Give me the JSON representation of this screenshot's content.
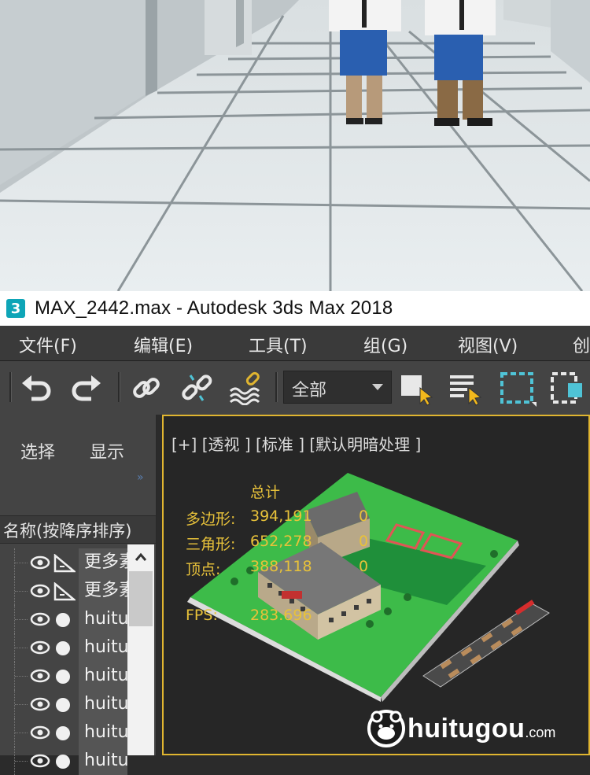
{
  "window": {
    "title": "MAX_2442.max - Autodesk 3ds Max 2018",
    "app_icon_glyph": "3"
  },
  "menu": [
    {
      "label": "文件(F)"
    },
    {
      "label": "编辑(E)"
    },
    {
      "label": "工具(T)"
    },
    {
      "label": "组(G)"
    },
    {
      "label": "视图(V)"
    },
    {
      "label": "创"
    }
  ],
  "toolbar": {
    "icons": [
      "undo-icon",
      "redo-icon",
      "link-icon",
      "unlink-icon",
      "bind-space-warp-icon",
      "select-object-icon",
      "select-by-name-icon",
      "rectangular-selection-region-icon",
      "window-crossing-icon"
    ],
    "selection_set_value": "全部",
    "accent_color": "#4fc3d6"
  },
  "left_panel": {
    "tabs": [
      "选择",
      "显示"
    ],
    "expand_glyph": "»",
    "column_header": "名称(按降序排序)",
    "rows": [
      {
        "name": "更多素",
        "kind": "helper"
      },
      {
        "name": "更多素",
        "kind": "helper"
      },
      {
        "name": "huitu",
        "kind": "geometry"
      },
      {
        "name": "huitu",
        "kind": "geometry"
      },
      {
        "name": "huitu",
        "kind": "geometry"
      },
      {
        "name": "huitu",
        "kind": "geometry"
      },
      {
        "name": "huitu",
        "kind": "geometry"
      },
      {
        "name": "huitu",
        "kind": "geometry"
      }
    ]
  },
  "viewport": {
    "label": "[+] [透视 ] [标准 ] [默认明暗处理 ]",
    "border_color": "#e0b530",
    "stats": {
      "header": "总计",
      "polygons_label": "多边形:",
      "polygons_value": "394,191",
      "polygons_sel": "0",
      "triangles_label": "三角形:",
      "triangles_value": "652,278",
      "triangles_sel": "0",
      "vertices_label": "顶点:",
      "vertices_value": "388,118",
      "vertices_sel": "0",
      "fps_label": "FPS:",
      "fps_value": "283.696"
    }
  },
  "watermark": {
    "text": "huitugou",
    "domain": ".com"
  }
}
